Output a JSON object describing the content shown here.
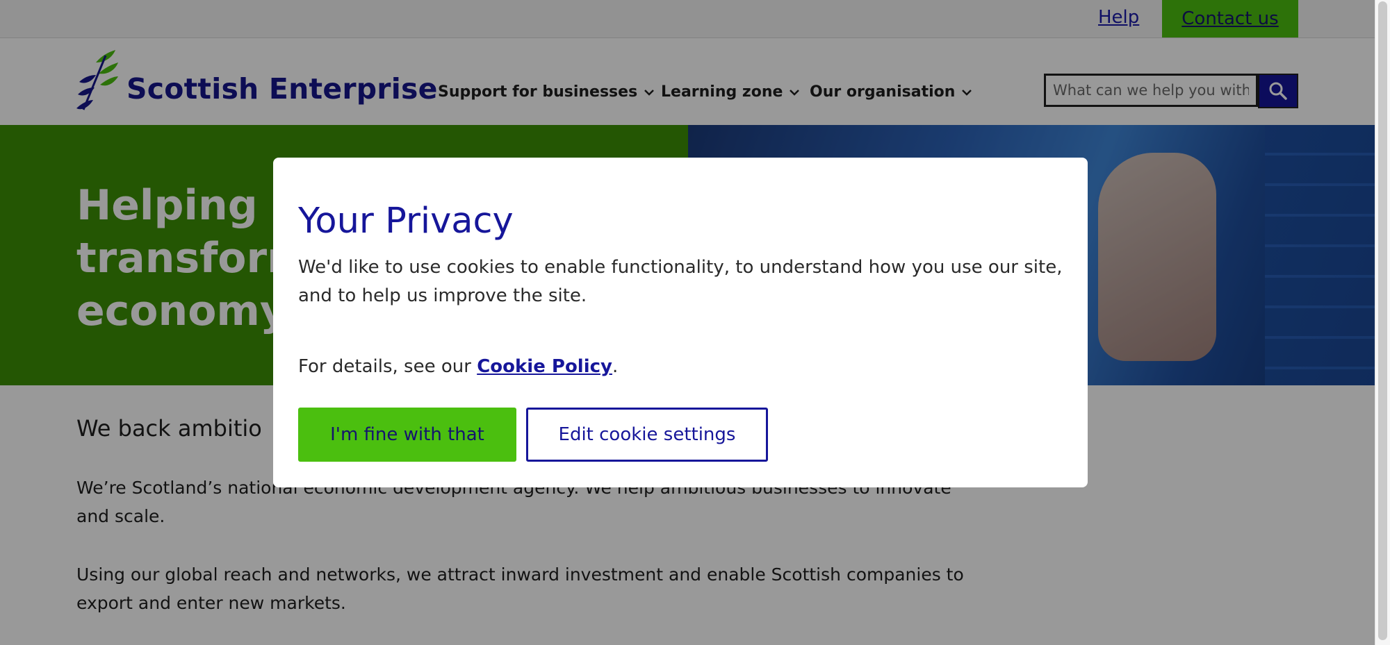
{
  "utility": {
    "help_label": "Help",
    "contact_label": "Contact us"
  },
  "header": {
    "logo_text": "Scottish Enterprise",
    "nav": [
      {
        "label": "Support for businesses",
        "icon": "chevron-down-icon"
      },
      {
        "label": "Learning zone",
        "icon": "chevron-down-icon"
      },
      {
        "label": "Our organisation",
        "icon": "chevron-down-icon"
      }
    ],
    "search": {
      "placeholder": "What can we help you with?",
      "icon": "search-icon"
    }
  },
  "hero": {
    "title": "Helping b\ntransform\neconomy"
  },
  "content": {
    "lead": "We back ambitio",
    "para1": "We’re Scotland’s national economic development agency. We help ambitious businesses to innovate and scale.",
    "para2": "Using our global reach and networks, we attract inward investment and enable Scottish companies to export and enter new markets."
  },
  "cookie_modal": {
    "title": "Your Privacy",
    "body": "We'd like to use cookies to enable functionality, to understand how you use our site, and to help us improve the site.",
    "details_prefix": "For details, see our ",
    "policy_link": "Cookie Policy",
    "details_suffix": ".",
    "accept_label": "I'm fine with that",
    "edit_label": "Edit cookie settings"
  },
  "colors": {
    "brand_blue": "#16169a",
    "brand_green": "#4bbf0f",
    "hero_green": "#3d8f06"
  }
}
